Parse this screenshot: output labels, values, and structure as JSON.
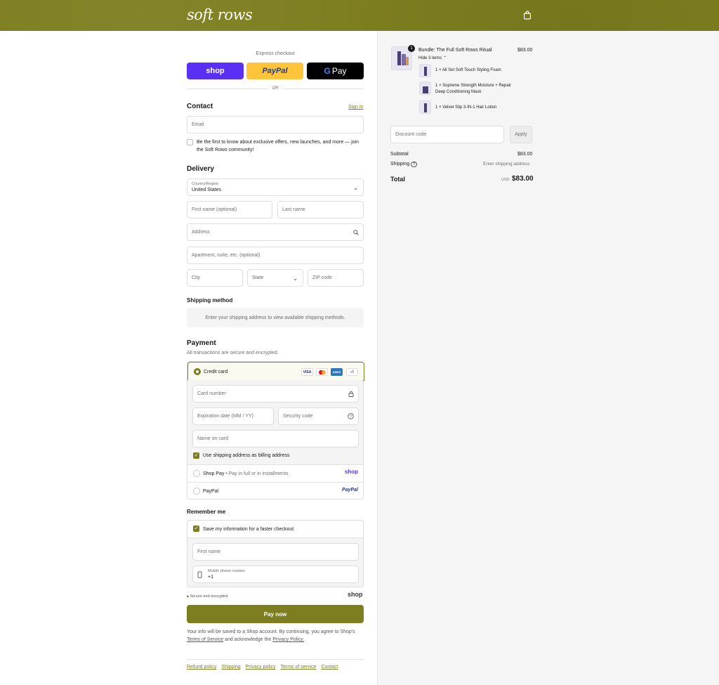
{
  "header": {
    "logo": "soft rows",
    "cart_icon": "bag-icon"
  },
  "express": {
    "label": "Express checkout",
    "shop": "shop",
    "paypal": "PayPal",
    "gpay_g": "G",
    "gpay": "Pay",
    "or": "OR"
  },
  "contact": {
    "title": "Contact",
    "sign_in": "Sign in",
    "email_placeholder": "Email",
    "newsletter": "Be the first to know about exclusive offers, new launches, and more — join the Soft Rows community!"
  },
  "delivery": {
    "title": "Delivery",
    "country_label": "Country/Region",
    "country_value": "United States",
    "first_name": "First name (optional)",
    "last_name": "Last name",
    "address": "Address",
    "apartment": "Apartment, suite, etc. (optional)",
    "city": "City",
    "state": "State",
    "zip": "ZIP code"
  },
  "shipping_method": {
    "title": "Shipping method",
    "message": "Enter your shipping address to view available shipping methods."
  },
  "payment": {
    "title": "Payment",
    "subtitle": "All transactions are secure and encrypted.",
    "credit_card": "Credit card",
    "card_logos": [
      "VISA",
      "MC",
      "AMEX",
      "+5"
    ],
    "card_number": "Card number",
    "expiration": "Expiration date (MM / YY)",
    "security_code": "Security code",
    "name_on_card": "Name on card",
    "billing_same": "Use shipping address as billing address",
    "shop_pay": "Shop Pay",
    "shop_pay_sub": "• Pay in full or in installments",
    "shop_pay_logo": "shop",
    "paypal": "PayPal",
    "paypal_logo": "PayPal"
  },
  "remember": {
    "title": "Remember me",
    "save_info": "Save my information for a faster checkout",
    "first_name": "First name",
    "phone_label": "Mobile phone number",
    "phone_value": "+1",
    "secure": "Secure and encrypted",
    "shop_logo": "shop"
  },
  "pay_now": "Pay now",
  "disclaimer": {
    "pre": "Your info will be saved to a Shop account. By continuing, you agree to Shop's",
    "tos": "Terms of Service",
    "mid": "and acknowledge the",
    "privacy": "Privacy Policy."
  },
  "footer": {
    "links": [
      "Refund policy",
      "Shipping",
      "Privacy policy",
      "Terms of service",
      "Contact"
    ]
  },
  "summary": {
    "quantity": "1",
    "product": "Bundle: The Full Soft Rows Ritual",
    "price": "$83.00",
    "hide_items": "Hide 3 items",
    "items": [
      "1 × All Set Soft Touch Styling Foam",
      "1 × Supreme Strength Moisture + Repair",
      "Deep Conditioning Mask",
      "1 × Velvet Slip 3-IN-1 Hair Lotion"
    ],
    "discount_placeholder": "Discount code",
    "apply": "Apply",
    "subtotal_label": "Subtotal",
    "subtotal": "$83.00",
    "shipping_label": "Shipping",
    "shipping_value": "Enter shipping address",
    "total_label": "Total",
    "currency": "USD",
    "total": "$83.00"
  },
  "colors": {
    "accent": "#7d7e1f",
    "shop_purple": "#5a31f4",
    "paypal_yellow": "#ffc439"
  }
}
